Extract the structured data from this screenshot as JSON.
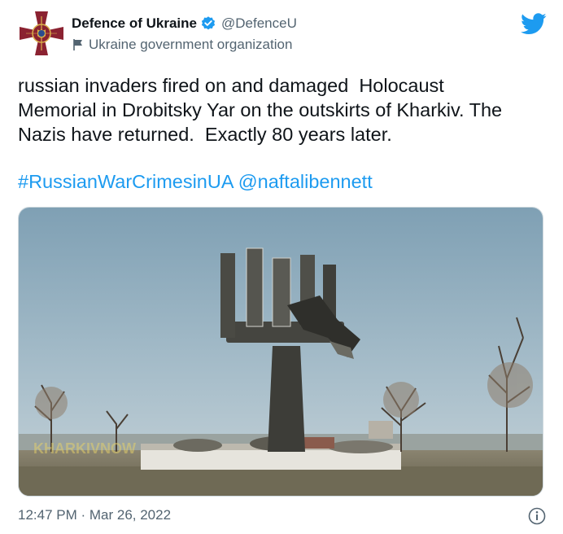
{
  "account": {
    "display_name": "Defence of Ukraine",
    "handle": "@DefenceU",
    "label": "Ukraine government organization"
  },
  "tweet": {
    "text": "russian invaders fired on and damaged  Holocaust\nMemorial in Drobitsky Yar on the outskirts of Kharkiv. The\nNazis have returned.  Exactly 80 years later.",
    "hashtag": "#RussianWarCrimesinUA",
    "mention": "@naftalibennett",
    "timestamp": "12:47 PM · Mar 26, 2022"
  },
  "media": {
    "watermark": "KHARKIVNOW"
  },
  "icons": {
    "avatar": "ukraine-armed-forces-emblem",
    "verified": "verified-badge-icon",
    "label": "flag-icon",
    "brand": "twitter-bird-icon",
    "info": "info-icon"
  },
  "colors": {
    "accent": "#1d9bf0",
    "text": "#0f1419",
    "secondary": "#536471",
    "avatar_bg": "#8b2231",
    "avatar_gold": "#d9b04a"
  }
}
